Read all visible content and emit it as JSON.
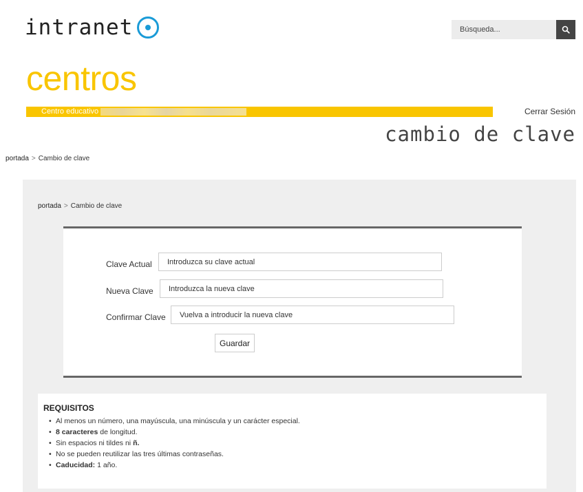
{
  "header": {
    "logo_text": "intranet",
    "brand": "centros",
    "centro_label": "Centro educativo",
    "logout_label": "Cerrar Sesión",
    "page_heading": "cambio de clave"
  },
  "search": {
    "placeholder": "Búsqueda...",
    "icon": "search-icon"
  },
  "breadcrumb": {
    "home": "portada",
    "separator": ">",
    "current": "Cambio de clave"
  },
  "form": {
    "current_label": "Clave Actual",
    "current_placeholder": "Introduzca su clave actual",
    "new_label": "Nueva Clave",
    "new_placeholder": "Introduzca la nueva clave",
    "confirm_label": "Confirmar Clave",
    "confirm_placeholder": "Vuelva a introducir la nueva clave",
    "save_label": "Guardar"
  },
  "requirements": {
    "title": "REQUISITOS",
    "item1": "Al menos un número, una mayúscula, una minúscula y un carácter especial.",
    "item2_bold": "8 caracteres",
    "item2_rest": " de longitud.",
    "item3_text": "Sin espacios ni tildes ni ",
    "item3_bold": "ñ.",
    "item4": "No se pueden reutilizar las tres últimas contraseñas.",
    "item5_bold": "Caducidad:",
    "item5_rest": " 1 año."
  },
  "colors": {
    "brand_yellow": "#f9c500",
    "logo_blue": "#1a9bd7",
    "search_button": "#444444",
    "panel_bg": "#efefef"
  }
}
